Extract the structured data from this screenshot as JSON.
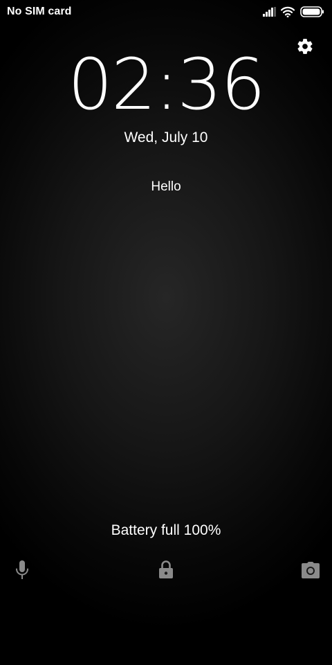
{
  "status_bar": {
    "carrier": "No SIM card",
    "icons": [
      "signal-icon",
      "wifi-icon",
      "battery-icon"
    ],
    "battery_level": 1.0
  },
  "lockscreen": {
    "time": "02:36",
    "date": "Wed, July 10",
    "owner_message": "Hello",
    "battery_status": "Battery full 100%",
    "settings_icon": "gear-icon",
    "shortcuts": [
      "microphone-icon",
      "lock-icon",
      "camera-icon"
    ]
  },
  "colors": {
    "text": "#ffffff",
    "icon_dim": "#8a8a8a",
    "background_center": "#262626",
    "background_edge": "#000000"
  }
}
